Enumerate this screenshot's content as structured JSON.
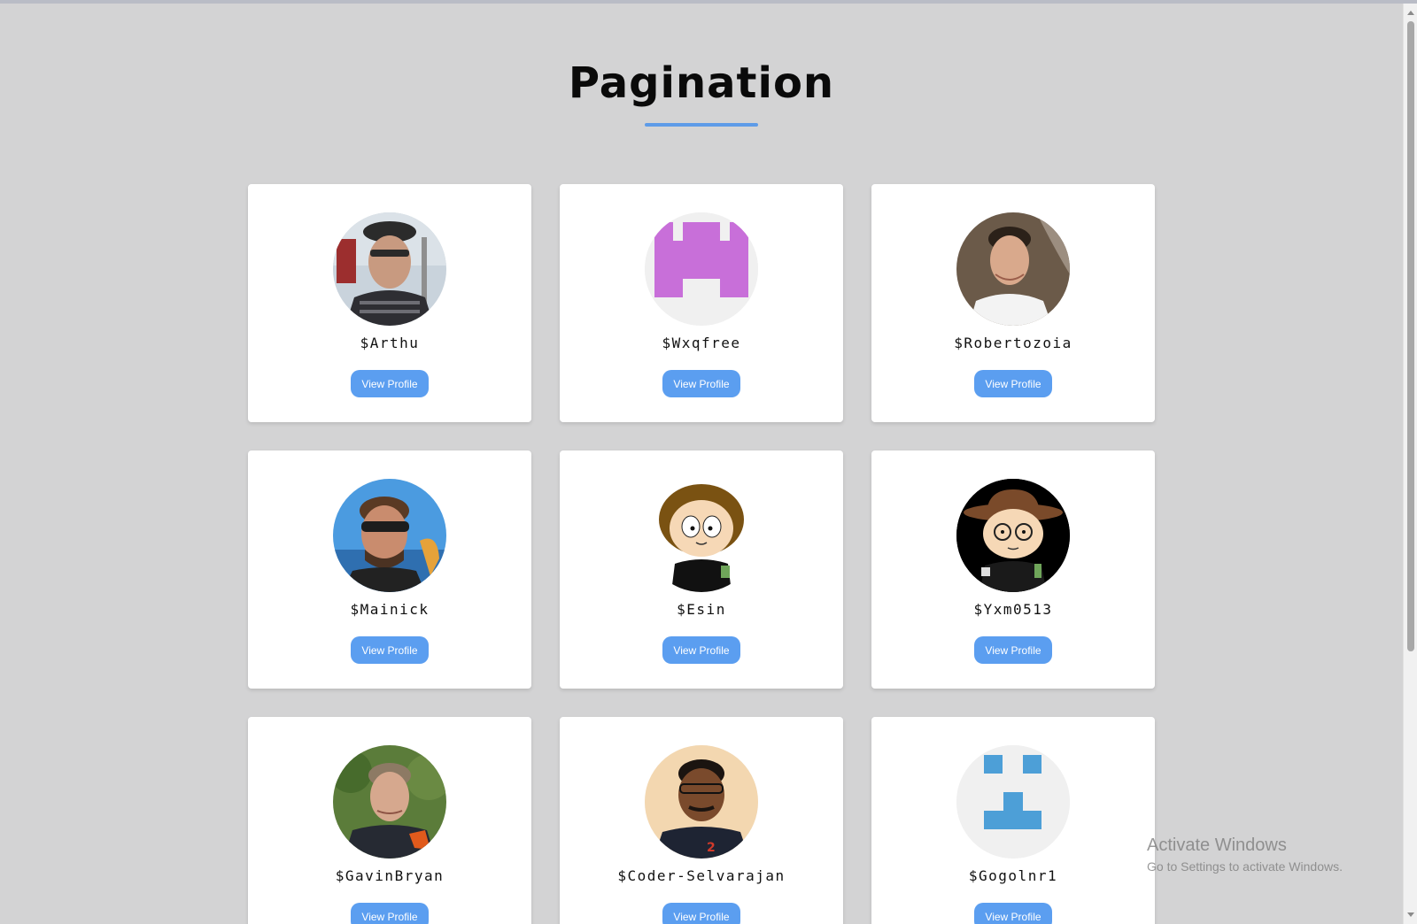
{
  "page": {
    "title": "Pagination",
    "accent_color": "#5d9be8"
  },
  "cards": [
    {
      "username": "$Arthu",
      "button": "View Profile",
      "avatar": "person-photo-cap"
    },
    {
      "username": "$Wxqfree",
      "button": "View Profile",
      "avatar": "identicon-purple"
    },
    {
      "username": "$Robertozoia",
      "button": "View Profile",
      "avatar": "person-photo"
    },
    {
      "username": "$Mainick",
      "button": "View Profile",
      "avatar": "person-photo-sunglasses"
    },
    {
      "username": "$Esin",
      "button": "View Profile",
      "avatar": "cartoon-character"
    },
    {
      "username": "$Yxm0513",
      "button": "View Profile",
      "avatar": "cartoon-character-hat"
    },
    {
      "username": "$GavinBryan",
      "button": "View Profile",
      "avatar": "person-photo"
    },
    {
      "username": "$Coder-Selvarajan",
      "button": "View Profile",
      "avatar": "person-photo"
    },
    {
      "username": "$Gogolnr1",
      "button": "View Profile",
      "avatar": "identicon-blue"
    }
  ],
  "watermark": {
    "title": "Activate Windows",
    "subtitle": "Go to Settings to activate Windows."
  }
}
